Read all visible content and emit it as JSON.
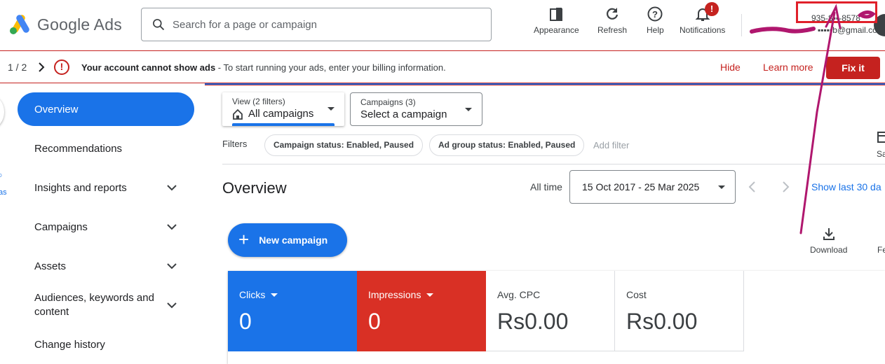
{
  "header": {
    "logo_text": "Google Ads",
    "search_placeholder": "Search for a page or campaign",
    "buttons": [
      {
        "label": "Appearance",
        "icon": "appearance-icon"
      },
      {
        "label": "Refresh",
        "icon": "refresh-icon"
      },
      {
        "label": "Help",
        "icon": "help-icon"
      },
      {
        "label": "Notifications",
        "icon": "bell-icon"
      }
    ],
    "notification_badge": "!",
    "account_id": "935-8▪▪-8578",
    "account_email": "▪▪▪▪▪b@gmail.com"
  },
  "alert": {
    "count": "1 / 2",
    "icon": "!",
    "title": "Your account cannot show ads",
    "message": " - To start running your ads, enter your billing information.",
    "hide": "Hide",
    "learn_more": "Learn more",
    "fix": "Fix it"
  },
  "sidebar": {
    "items": [
      {
        "label": "Overview",
        "active": true
      },
      {
        "label": "Recommendations"
      },
      {
        "label": "Insights and reports"
      },
      {
        "label": "Campaigns"
      },
      {
        "label": "Assets"
      },
      {
        "label": "Audiences, keywords and content"
      },
      {
        "label": "Change history"
      }
    ],
    "edge_fragment": "as"
  },
  "filters": {
    "view_label": "View (2 filters)",
    "view_value": "All campaigns",
    "campaigns_label": "Campaigns (3)",
    "campaigns_value": "Select a campaign",
    "filters_label": "Filters",
    "chips": [
      "Campaign status: Enabled, Paused",
      "Ad group status: Enabled, Paused"
    ],
    "add_filter": "Add filter",
    "segment_label": "Sa"
  },
  "overview": {
    "title": "Overview",
    "all_time": "All time",
    "date_range": "15 Oct 2017 - 25 Mar 2025",
    "show_last": "Show last 30 da",
    "new_campaign": "New campaign",
    "download": "Download",
    "feedback_fragment": "Fe"
  },
  "metrics": [
    {
      "label": "Clicks",
      "value": "0",
      "color": "#1a73e8"
    },
    {
      "label": "Impressions",
      "value": "0",
      "color": "#d93025"
    },
    {
      "label": "Avg. CPC",
      "value": "Rs0.00"
    },
    {
      "label": "Cost",
      "value": "Rs0.00"
    }
  ],
  "colors": {
    "brand_blue": "#1a73e8",
    "alert_red": "#c5221f",
    "annotation_red": "#e0202a",
    "annotation_magenta": "#b0176e"
  }
}
